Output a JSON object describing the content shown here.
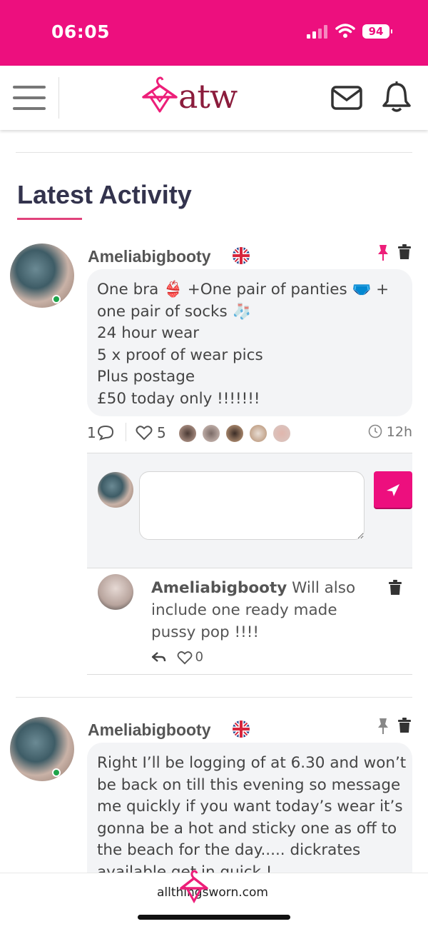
{
  "status_bar": {
    "time": "06:05",
    "battery": "94"
  },
  "header": {
    "logo_text": "atw"
  },
  "section": {
    "title": "Latest Activity"
  },
  "posts": [
    {
      "username": "Ameliabigbooty",
      "lines": [
        "One bra 👙 +One pair of panties 🩲 +",
        "one pair of socks 🧦",
        "24 hour wear",
        "5 x proof of wear pics",
        "Plus postage",
        "£50 today only !!!!!!!"
      ],
      "comments_count": "1",
      "likes_count": "5",
      "time": "12h",
      "pinned": true,
      "pin_color": "#ed1e79"
    },
    {
      "username": "Ameliabigbooty",
      "lines": [
        "Right I’ll be logging of at 6.30 and won’t",
        "be back on till this evening so message",
        "me quickly if you want today’s wear it’s",
        "gonna be a hot and sticky one as off to",
        "the beach for the day..... dickrates",
        "available get in quick !"
      ],
      "pinned": false,
      "pin_color": "#888888"
    }
  ],
  "reply": {
    "placeholder": ""
  },
  "comment": {
    "username": "Ameliabigbooty",
    "text": "Will also include one ready made pussy pop !!!!",
    "likes": "0"
  },
  "footer": {
    "site": "allthingsworn.com"
  },
  "colors": {
    "brand": "#ed0f7e",
    "title": "#33334d"
  }
}
